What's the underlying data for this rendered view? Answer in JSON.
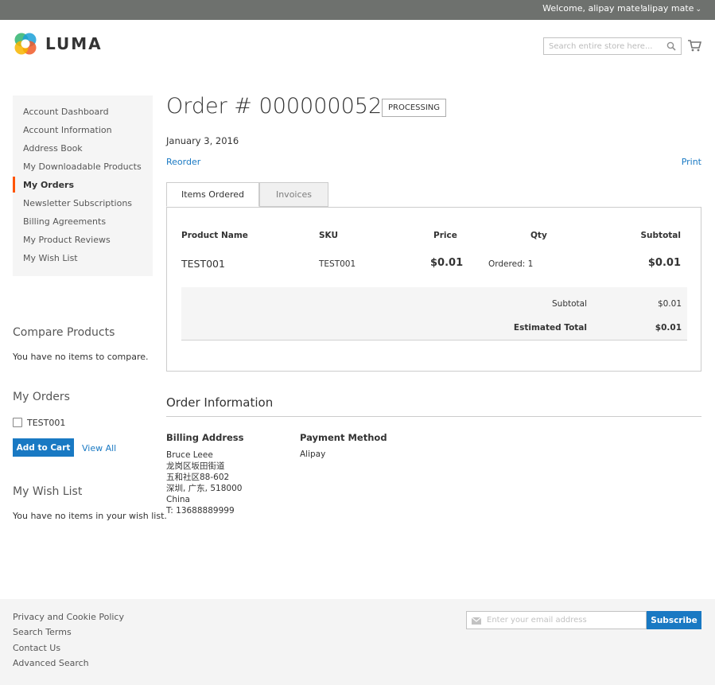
{
  "header": {
    "welcome": "Welcome, alipay mate!",
    "user_menu": "alipay mate",
    "logo_text": "LUMA",
    "search_placeholder": "Search entire store here...",
    "icons": [
      "chevron-down-icon",
      "search-icon",
      "cart-icon",
      "luma-logo-icon"
    ]
  },
  "sidebar": {
    "nav": [
      {
        "label": "Account Dashboard"
      },
      {
        "label": "Account Information"
      },
      {
        "label": "Address Book"
      },
      {
        "label": "My Downloadable Products"
      },
      {
        "label": "My Orders"
      },
      {
        "label": "Newsletter Subscriptions"
      },
      {
        "label": "Billing Agreements"
      },
      {
        "label": "My Product Reviews"
      },
      {
        "label": "My Wish List"
      }
    ],
    "current_nav": "My Orders",
    "compare": {
      "title": "Compare Products",
      "empty": "You have no items to compare."
    },
    "my_orders": {
      "title": "My Orders",
      "item": "TEST001",
      "add_to_cart": "Add to Cart",
      "view_all": "View All"
    },
    "wishlist": {
      "title": "My Wish List",
      "empty": "You have no items in your wish list."
    }
  },
  "order": {
    "title": "Order # 000000052",
    "status": "PROCESSING",
    "date": "January 3, 2016",
    "reorder": "Reorder",
    "print": "Print",
    "tabs": [
      {
        "label": "Items Ordered",
        "active": true
      },
      {
        "label": "Invoices",
        "active": false
      }
    ],
    "table": {
      "headers": {
        "name": "Product Name",
        "sku": "SKU",
        "price": "Price",
        "qty": "Qty",
        "subtotal": "Subtotal"
      },
      "rows": [
        {
          "name": "TEST001",
          "sku": "TEST001",
          "price": "$0.01",
          "qty": "Ordered: 1",
          "subtotal": "$0.01"
        }
      ],
      "totals": {
        "subtotal_label": "Subtotal",
        "subtotal_value": "$0.01",
        "grand_label": "Estimated Total",
        "grand_value": "$0.01"
      }
    },
    "info": {
      "title": "Order Information",
      "billing_title": "Billing Address",
      "billing_lines": [
        "Bruce Leee",
        "龙岗区坂田街道",
        "五和社区88-602",
        "深圳, 广东, 518000",
        "China"
      ],
      "billing_phone_prefix": "T: ",
      "billing_phone": "13688889999",
      "payment_title": "Payment Method",
      "payment_value": "Alipay"
    }
  },
  "footer": {
    "links": [
      "Privacy and Cookie Policy",
      "Search Terms",
      "Contact Us",
      "Advanced Search"
    ],
    "newsletter_placeholder": "Enter your email address",
    "subscribe": "Subscribe"
  },
  "colors": {
    "primary": "#1979c3",
    "accent_current_nav": "#ff5501",
    "top_bar": "#6e716e",
    "footer_bg": "#f4f4f4"
  }
}
